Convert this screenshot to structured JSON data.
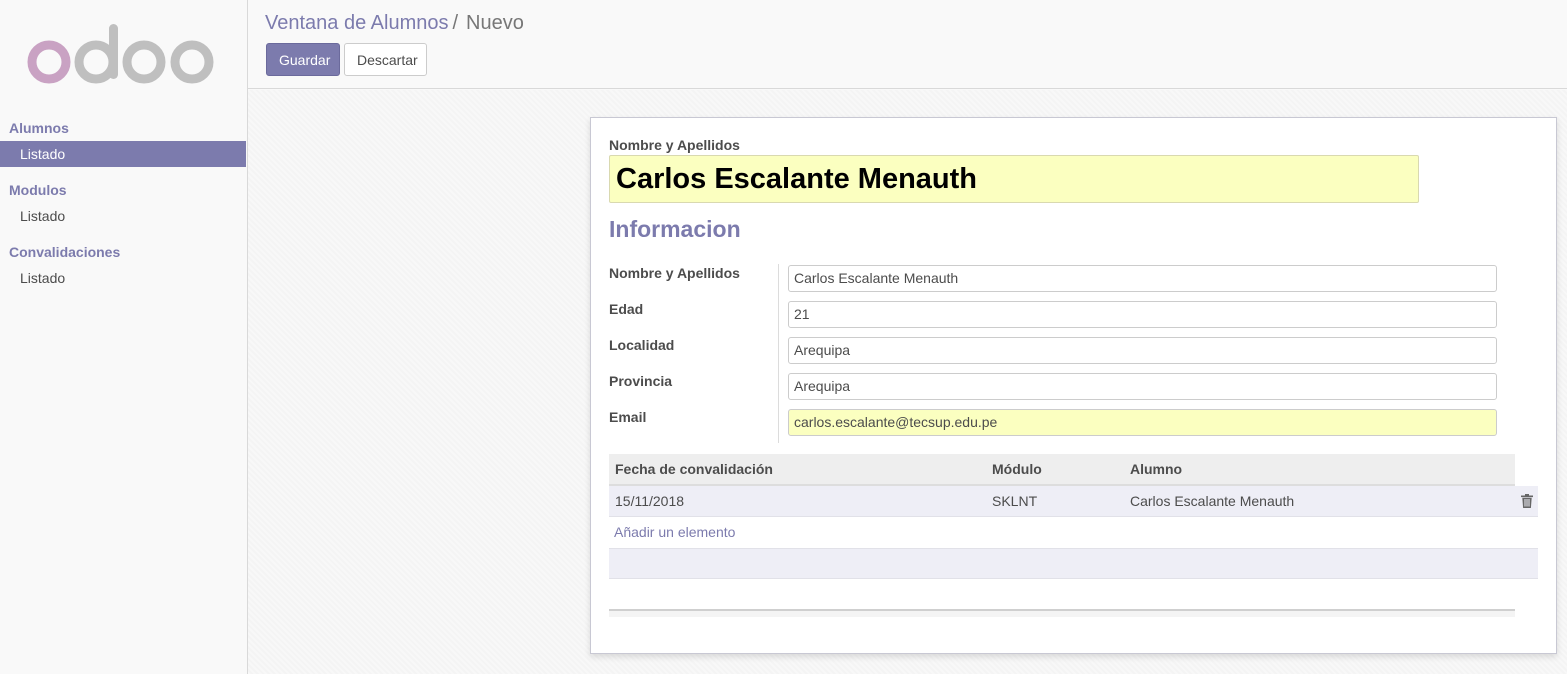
{
  "brand": {
    "logo_text": "odoo",
    "logo_colors": [
      "#c9a2c3",
      "#bfbfbf"
    ]
  },
  "sidebar": {
    "sections": [
      {
        "label": "Alumnos",
        "items": [
          {
            "label": "Listado",
            "active": true
          }
        ]
      },
      {
        "label": "Modulos",
        "items": [
          {
            "label": "Listado",
            "active": false
          }
        ]
      },
      {
        "label": "Convalidaciones",
        "items": [
          {
            "label": "Listado",
            "active": false
          }
        ]
      }
    ]
  },
  "breadcrumb": {
    "parent": "Ventana de Alumnos",
    "separator": "/",
    "current": "Nuevo"
  },
  "buttons": {
    "save": "Guardar",
    "discard": "Descartar"
  },
  "form": {
    "title_label": "Nombre y Apellidos",
    "title_value": "Carlos Escalante Menauth",
    "section_title": "Informacion",
    "fields": [
      {
        "label": "Nombre y Apellidos",
        "value": "Carlos Escalante Menauth",
        "required": false
      },
      {
        "label": "Edad",
        "value": "21",
        "required": false
      },
      {
        "label": "Localidad",
        "value": "Arequipa",
        "required": false
      },
      {
        "label": "Provincia",
        "value": "Arequipa",
        "required": false
      },
      {
        "label": "Email",
        "value": "carlos.escalante@tecsup.edu.pe",
        "required": true
      }
    ]
  },
  "table": {
    "columns": [
      "Fecha de convalidación",
      "Módulo",
      "Alumno"
    ],
    "rows": [
      [
        "15/11/2018",
        "SKLNT",
        "Carlos Escalante Menauth"
      ]
    ],
    "add_label": "Añadir un elemento"
  },
  "colors": {
    "accent": "#7c7bad",
    "required_bg": "#fbffc0"
  },
  "icons": {
    "row_delete": "trash-icon"
  }
}
